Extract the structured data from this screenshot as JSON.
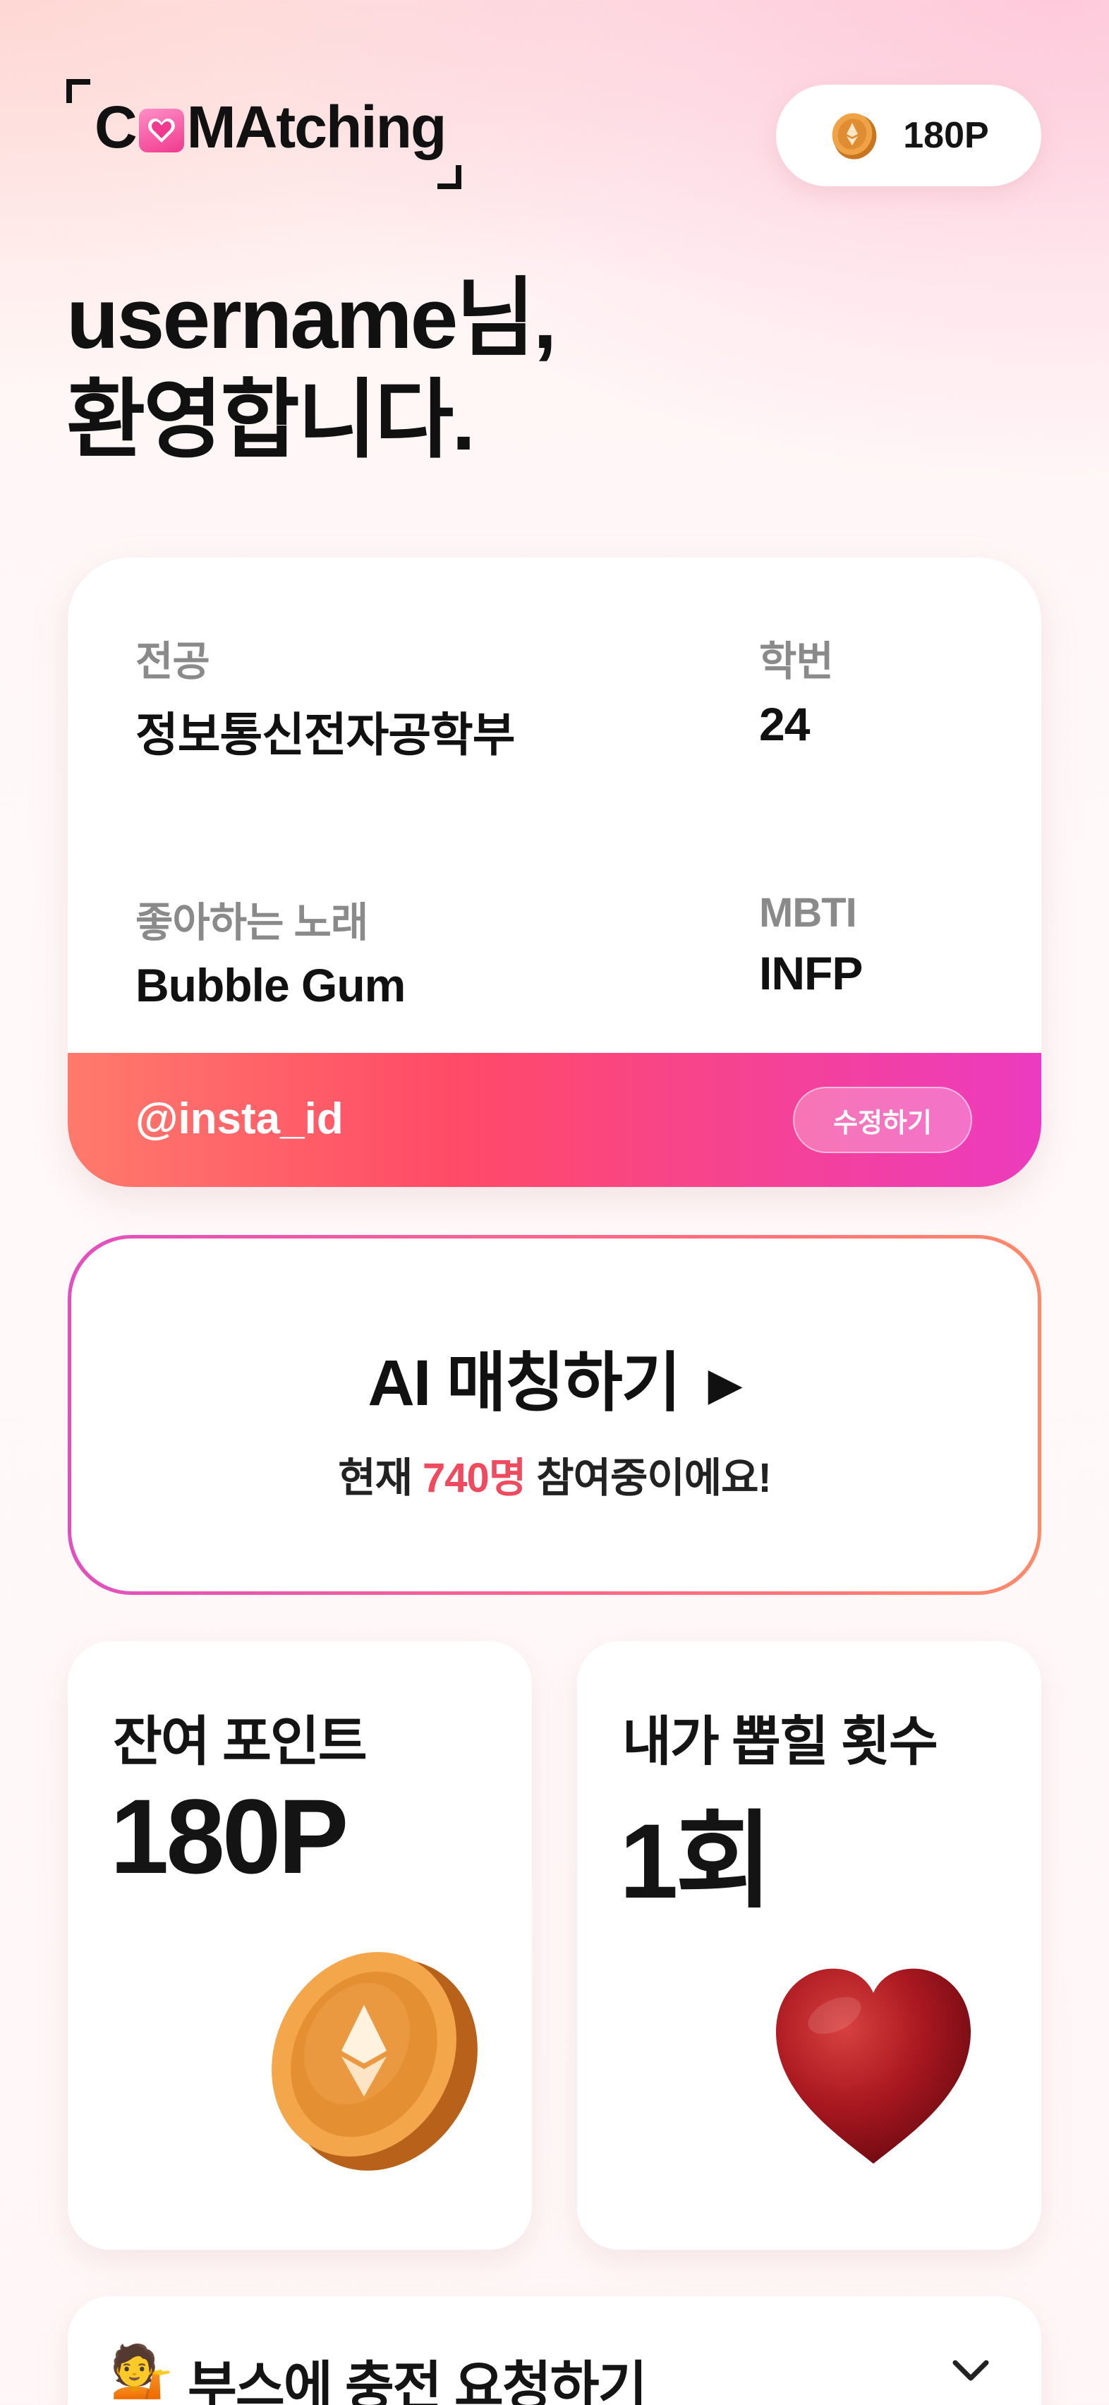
{
  "header": {
    "logo_text_start": "C",
    "logo_text_end": "MAtching",
    "points_label": "180P"
  },
  "welcome": {
    "line1": "username님,",
    "line2": "환영합니다."
  },
  "profile": {
    "major_label": "전공",
    "major_value": "정보통신전자공학부",
    "student_id_label": "학번",
    "student_id_value": "24",
    "song_label": "좋아하는 노래",
    "song_value": "Bubble Gum",
    "mbti_label": "MBTI",
    "mbti_value": "INFP",
    "instagram": "@insta_id",
    "edit_label": "수정하기"
  },
  "ai_match": {
    "title": "AI 매칭하기",
    "play_icon": "play-triangle-icon",
    "sub_prefix": "현재 ",
    "sub_count": "740명",
    "sub_suffix": " 참여중이에요!"
  },
  "stats": {
    "points_label": "잔여 포인트",
    "points_value": "180P",
    "picked_label": "내가 뽑힐 횟수",
    "picked_value": "1회"
  },
  "booth": {
    "emoji": "💁",
    "label": "부스에 충전 요청하기"
  },
  "colors": {
    "accent_red": "#f04a5f",
    "gradient_start": "#ff7a6b",
    "gradient_end": "#ec3bbf"
  }
}
